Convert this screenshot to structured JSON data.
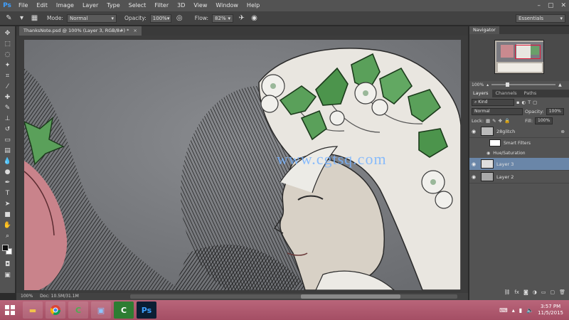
{
  "app": {
    "logo": "Ps",
    "menu": [
      "File",
      "Edit",
      "Image",
      "Layer",
      "Type",
      "Select",
      "Filter",
      "3D",
      "View",
      "Window",
      "Help"
    ],
    "window_controls": [
      "–",
      "▢",
      "✕"
    ]
  },
  "options": {
    "mode_label": "Mode:",
    "mode_value": "Normal",
    "opacity_label": "Opacity:",
    "opacity_value": "100%",
    "flow_label": "Flow:",
    "flow_value": "82%",
    "workspace": "Essentials"
  },
  "document": {
    "tab_title": "ThanksNote.psd @ 100% (Layer 3, RGB/8#) *",
    "close_glyph": "×",
    "status_doc": "Doc: 10.5M/31.1M",
    "zoom_status": "100%"
  },
  "watermark": "www.cgtsq.com",
  "navigator": {
    "title": "Navigator",
    "zoom": "100%"
  },
  "layers_panel": {
    "tabs": [
      "Layers",
      "Channels",
      "Paths"
    ],
    "kind_label": "Kind",
    "blend_mode": "Normal",
    "opacity_label": "Opacity:",
    "opacity_value": "100%",
    "lock_label": "Lock:",
    "fill_label": "Fill:",
    "fill_value": "100%",
    "layers": [
      {
        "name": "28glitch",
        "selected": false
      },
      {
        "name": "Smart Filters",
        "selected": false,
        "sub": true
      },
      {
        "name": "Hue/Saturation",
        "selected": false,
        "sub": true
      },
      {
        "name": "Layer 3",
        "selected": true
      },
      {
        "name": "Layer 2",
        "selected": false
      }
    ]
  },
  "taskbar": {
    "time": "3:57 PM",
    "date": "11/5/2015",
    "apps": [
      "file-explorer",
      "chrome",
      "camtasia",
      "screen-capture",
      "camtasia-recorder",
      "photoshop"
    ]
  },
  "colors": {
    "ui_dark": "#535353",
    "selected_layer": "#6a86a8",
    "taskbar": "#b0566d",
    "ps_blue": "#3fa0ff"
  }
}
